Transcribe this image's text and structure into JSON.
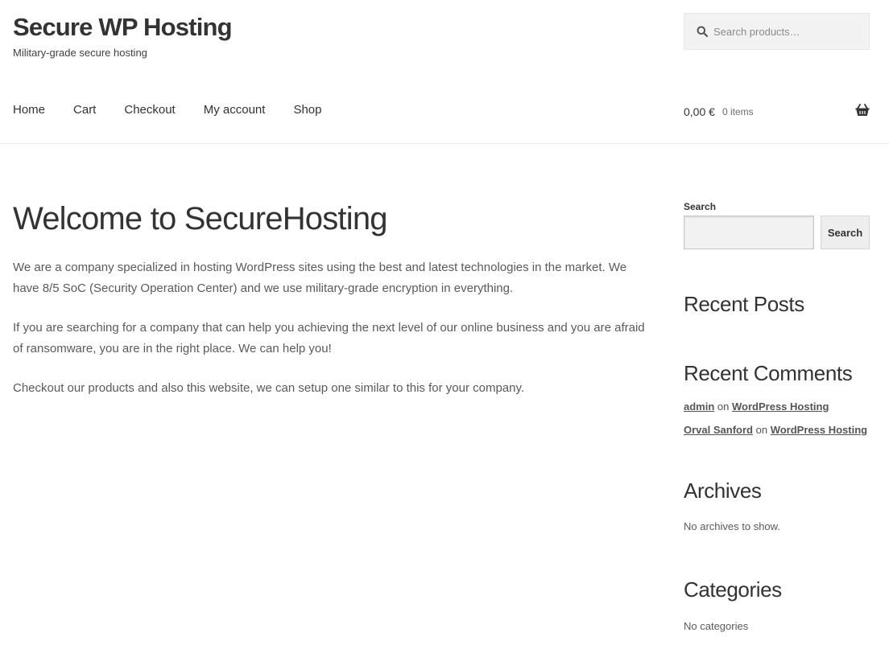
{
  "header": {
    "site_title": "Secure WP Hosting",
    "tagline": "Military-grade secure hosting",
    "search_placeholder": "Search products…",
    "search_icon": "magnifier-icon"
  },
  "nav": {
    "items": [
      "Home",
      "Cart",
      "Checkout",
      "My account",
      "Shop"
    ]
  },
  "cart": {
    "amount": "0,00 €",
    "count": "0 items",
    "icon": "basket-icon"
  },
  "page": {
    "title": "Welcome to SecureHosting",
    "paragraphs": [
      "We are a company specialized in hosting WordPress sites using the best and latest technologies in the market. We have 8/5 SoC (Security Operation Center) and we use military-grade encryption in everything.",
      "If you are searching for a company that can help you achieving the next level of our online business and you are afraid of ransomware, you are in the right place. We can help you!",
      "Checkout our products and also this website, we can setup one similar to this for your company."
    ]
  },
  "sidebar": {
    "search_label": "Search",
    "search_button": "Search",
    "recent_posts_title": "Recent Posts",
    "recent_comments_title": "Recent Comments",
    "comments": [
      {
        "author": "admin",
        "on": "on",
        "post": "WordPress Hosting"
      },
      {
        "author": "Orval Sanford",
        "on": "on",
        "post": "WordPress Hosting"
      }
    ],
    "archives_title": "Archives",
    "archives_note": "No archives to show.",
    "categories_title": "Categories",
    "categories_note": "No categories"
  },
  "colors": {
    "text": "#333333",
    "muted": "#6d6d6d",
    "input_bg": "#f2f2f2"
  }
}
